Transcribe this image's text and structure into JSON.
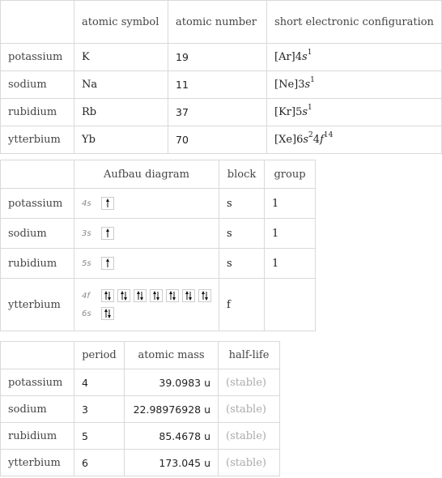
{
  "table1": {
    "headers": [
      "",
      "atomic symbol",
      "atomic number",
      "short electronic configuration"
    ],
    "rows": [
      {
        "name": "potassium",
        "symbol": "K",
        "number": "19",
        "config_core": "[Ar]",
        "config": [
          [
            "4",
            "s",
            "1"
          ]
        ]
      },
      {
        "name": "sodium",
        "symbol": "Na",
        "number": "11",
        "config_core": "[Ne]",
        "config": [
          [
            "3",
            "s",
            "1"
          ]
        ]
      },
      {
        "name": "rubidium",
        "symbol": "Rb",
        "number": "37",
        "config_core": "[Kr]",
        "config": [
          [
            "5",
            "s",
            "1"
          ]
        ]
      },
      {
        "name": "ytterbium",
        "symbol": "Yb",
        "number": "70",
        "config_core": "[Xe]",
        "config": [
          [
            "6",
            "s",
            "2"
          ],
          [
            "4",
            "f",
            "14"
          ]
        ]
      }
    ]
  },
  "table2": {
    "headers": [
      "",
      "Aufbau diagram",
      "block",
      "group"
    ],
    "rows": [
      {
        "name": "potassium",
        "orbitals": [
          {
            "label": "4s",
            "boxes": [
              "up"
            ]
          }
        ],
        "block": "s",
        "group": "1"
      },
      {
        "name": "sodium",
        "orbitals": [
          {
            "label": "3s",
            "boxes": [
              "up"
            ]
          }
        ],
        "block": "s",
        "group": "1"
      },
      {
        "name": "rubidium",
        "orbitals": [
          {
            "label": "5s",
            "boxes": [
              "up"
            ]
          }
        ],
        "block": "s",
        "group": "1"
      },
      {
        "name": "ytterbium",
        "orbitals": [
          {
            "label": "4f",
            "boxes": [
              "pair",
              "pair",
              "pair",
              "pair",
              "pair",
              "pair",
              "pair"
            ]
          },
          {
            "label": "6s",
            "boxes": [
              "pair"
            ]
          }
        ],
        "block": "f",
        "group": ""
      }
    ]
  },
  "table3": {
    "headers": [
      "",
      "period",
      "atomic mass",
      "half-life"
    ],
    "rows": [
      {
        "name": "potassium",
        "period": "4",
        "mass": "39.0983 u",
        "half_life": "(stable)"
      },
      {
        "name": "sodium",
        "period": "3",
        "mass": "22.98976928 u",
        "half_life": "(stable)"
      },
      {
        "name": "rubidium",
        "period": "5",
        "mass": "85.4678 u",
        "half_life": "(stable)"
      },
      {
        "name": "ytterbium",
        "period": "6",
        "mass": "173.045 u",
        "half_life": "(stable)"
      }
    ]
  }
}
